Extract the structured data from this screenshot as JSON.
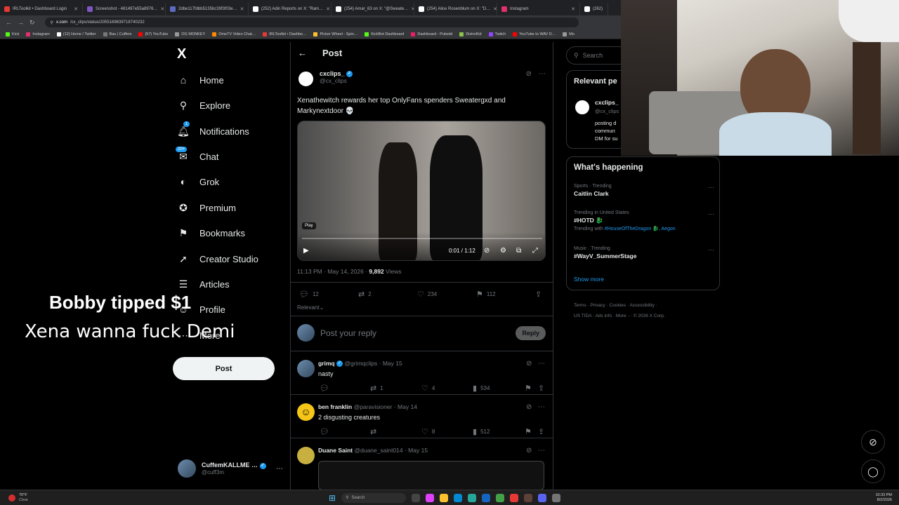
{
  "browser": {
    "tabs": [
      {
        "label": "IRLToolkit • Dashboard Login",
        "color": "#e53935"
      },
      {
        "label": "Screenshot - 481497e55a8976…",
        "color": "#7e57c2"
      },
      {
        "label": "2dbe117fdbb5135bc39f3f03e…",
        "color": "#5c6bc0"
      },
      {
        "label": "(252) Adin Reports on X: \"Ram…",
        "color": "#000000"
      },
      {
        "label": "(254) Amar_63 on X: \"@Sweate…",
        "color": "#000000"
      },
      {
        "label": "(254) Alice Rosenblum on X: \"D…",
        "color": "#000000"
      },
      {
        "label": "Instagram",
        "color": "#e1306c"
      },
      {
        "label": "(262)",
        "color": "#000000"
      }
    ],
    "url_host": "x.com",
    "url_path": "/cx_clips/status/2055169639718740232",
    "bookmarks": [
      {
        "label": "Kick",
        "color": "#53fc18"
      },
      {
        "label": "Instagram",
        "color": "#e1306c"
      },
      {
        "label": "(12) Home / Twitter",
        "color": "#ffffff"
      },
      {
        "label": "Bau | Cuffem",
        "color": "#777777"
      },
      {
        "label": "(57) YouTube",
        "color": "#ff0000"
      },
      {
        "label": "OG MONKEY",
        "color": "#999999"
      },
      {
        "label": "OmeTV Video Chat…",
        "color": "#ff8a00"
      },
      {
        "label": "IRLToolkit • Dashbo…",
        "color": "#e53935"
      },
      {
        "label": "Picker Wheel - Spin…",
        "color": "#fbc02d"
      },
      {
        "label": "KickBot Dashboard",
        "color": "#53fc18"
      },
      {
        "label": "Dashboard - Pulsoid",
        "color": "#e91e63"
      },
      {
        "label": "DistroKid",
        "color": "#8bc34a"
      },
      {
        "label": "Twitch",
        "color": "#9146ff"
      },
      {
        "label": "YouTube to WAV D…",
        "color": "#ff0000"
      },
      {
        "label": "Mo",
        "color": "#999999"
      }
    ]
  },
  "nav": {
    "logo": "X",
    "items": [
      {
        "label": "Home",
        "icon": "⌂",
        "name": "home"
      },
      {
        "label": "Explore",
        "icon": "⌕",
        "name": "explore"
      },
      {
        "label": "Notifications",
        "icon": "♫",
        "name": "notifications",
        "badge": "1"
      },
      {
        "label": "Chat",
        "icon": "✉",
        "name": "chat",
        "badge": "20+"
      },
      {
        "label": "Grok",
        "icon": "◐",
        "name": "grok"
      },
      {
        "label": "Premium",
        "icon": "✪",
        "name": "premium"
      },
      {
        "label": "Bookmarks",
        "icon": "⚑",
        "name": "bookmarks"
      },
      {
        "label": "Creator Studio",
        "icon": "➚",
        "name": "creator-studio"
      },
      {
        "label": "Articles",
        "icon": "☰",
        "name": "articles"
      },
      {
        "label": "Profile",
        "icon": "☺",
        "name": "profile"
      },
      {
        "label": "More",
        "icon": "⋯",
        "name": "more"
      }
    ],
    "post_label": "Post",
    "profile_name": "CuffemKALLME …",
    "profile_handle": "@cuff3m"
  },
  "overlay": {
    "tip": "Bobby tipped $1",
    "message": "Xena wanna fuck Demi"
  },
  "post": {
    "header_title": "Post",
    "author": "cxclips_",
    "handle": "@cx_clips",
    "text": "Xenathewitch rewards her top OnlyFans spenders Sweatergxd and Markynextdoor 💀",
    "video": {
      "hover_label": "Play",
      "time": "0:01 / 1:12"
    },
    "timestamp": "11:13 PM · May 14, 2026 · ",
    "views_count": "9,892",
    "views_label": " Views",
    "replies": "12",
    "reposts": "2",
    "likes": "234",
    "bookmarks": "112",
    "sort": "Relevant",
    "reply_placeholder": "Post your reply",
    "reply_button": "Reply"
  },
  "replies": [
    {
      "name": "grimq",
      "handle": "@grimqclips · May 15",
      "text": "nasty",
      "reply": "",
      "repost": "1",
      "like": "4",
      "views": "534",
      "verified": true
    },
    {
      "name": "ben franklin",
      "handle": "@paravisioner · May 14",
      "text": "2 disgusting creatures",
      "reply": "",
      "repost": "",
      "like": "8",
      "views": "512",
      "verified": false
    },
    {
      "name": "Duane Saint",
      "handle": "@duane_saint014 · May 15",
      "text": "",
      "verified": false
    }
  ],
  "sidebar": {
    "search_placeholder": "Search",
    "relevant_title": "Relevant pe",
    "relevant_name": "cxclips_",
    "relevant_handle": "@cx_clips",
    "relevant_bio_1": "posting d",
    "relevant_bio_2": "commun",
    "relevant_bio_3": "DM for su",
    "happening_title": "What's happening",
    "trends": [
      {
        "meta": "Sports · Trending",
        "name": "Caitlin Clark",
        "extra": ""
      },
      {
        "meta": "Trending in United States",
        "name": "#HOTD 🐉",
        "extra_prefix": "Trending with ",
        "extra_link": "#HouseOfTheDragon 🐉, Aegon"
      },
      {
        "meta": "Music · Trending",
        "name": "#WayV_SummerStage",
        "extra": ""
      }
    ],
    "show_more": "Show more",
    "footer_1": "Terms · Privacy · Cookies · Accessibility ·",
    "footer_2": "US TIDA · Ads info · More ··· © 2026 X Corp."
  },
  "taskbar": {
    "weather_temp": "70°F",
    "weather_desc": "Clear",
    "search": "Search",
    "time": "10:33 PM",
    "date": "8/2/2026"
  },
  "colors": {
    "accent": "#1d9bf0",
    "background": "#000000",
    "border": "#2f3336"
  }
}
